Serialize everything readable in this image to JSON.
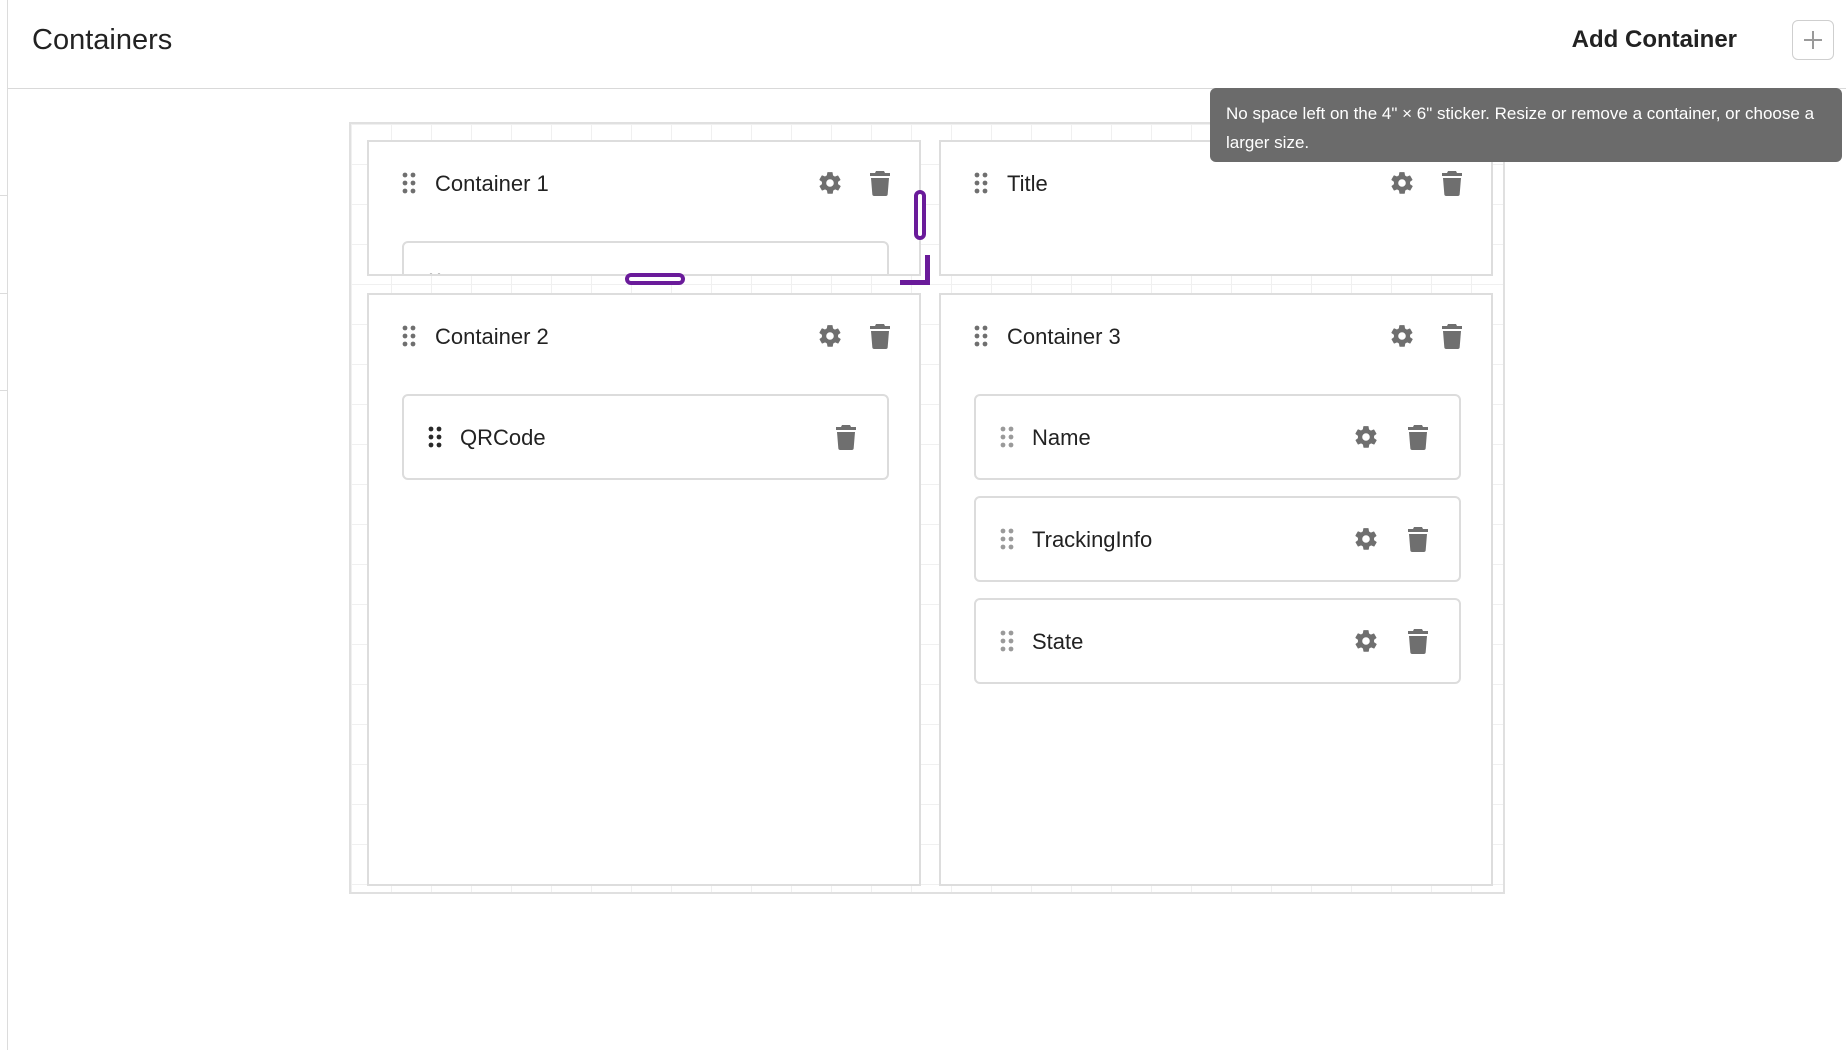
{
  "header": {
    "title": "Containers",
    "add_label": "Add Container",
    "add_icon": "plus-icon"
  },
  "tooltip": {
    "text": "No space left on the 4\" × 6\" sticker. Resize or remove a container, or choose a larger size."
  },
  "containers": [
    {
      "title": "Container 1",
      "fields": []
    },
    {
      "title": "Title",
      "fields": []
    },
    {
      "title": "Container 2",
      "fields": [
        {
          "label": "QRCode"
        }
      ]
    },
    {
      "title": "Container 3",
      "fields": [
        {
          "label": "Name"
        },
        {
          "label": "TrackingInfo"
        },
        {
          "label": "State"
        }
      ]
    }
  ],
  "colors": {
    "accent_selection": "#6a1b9a",
    "icon": "#6f6f6f",
    "tooltip_bg": "#6b6b6b"
  }
}
